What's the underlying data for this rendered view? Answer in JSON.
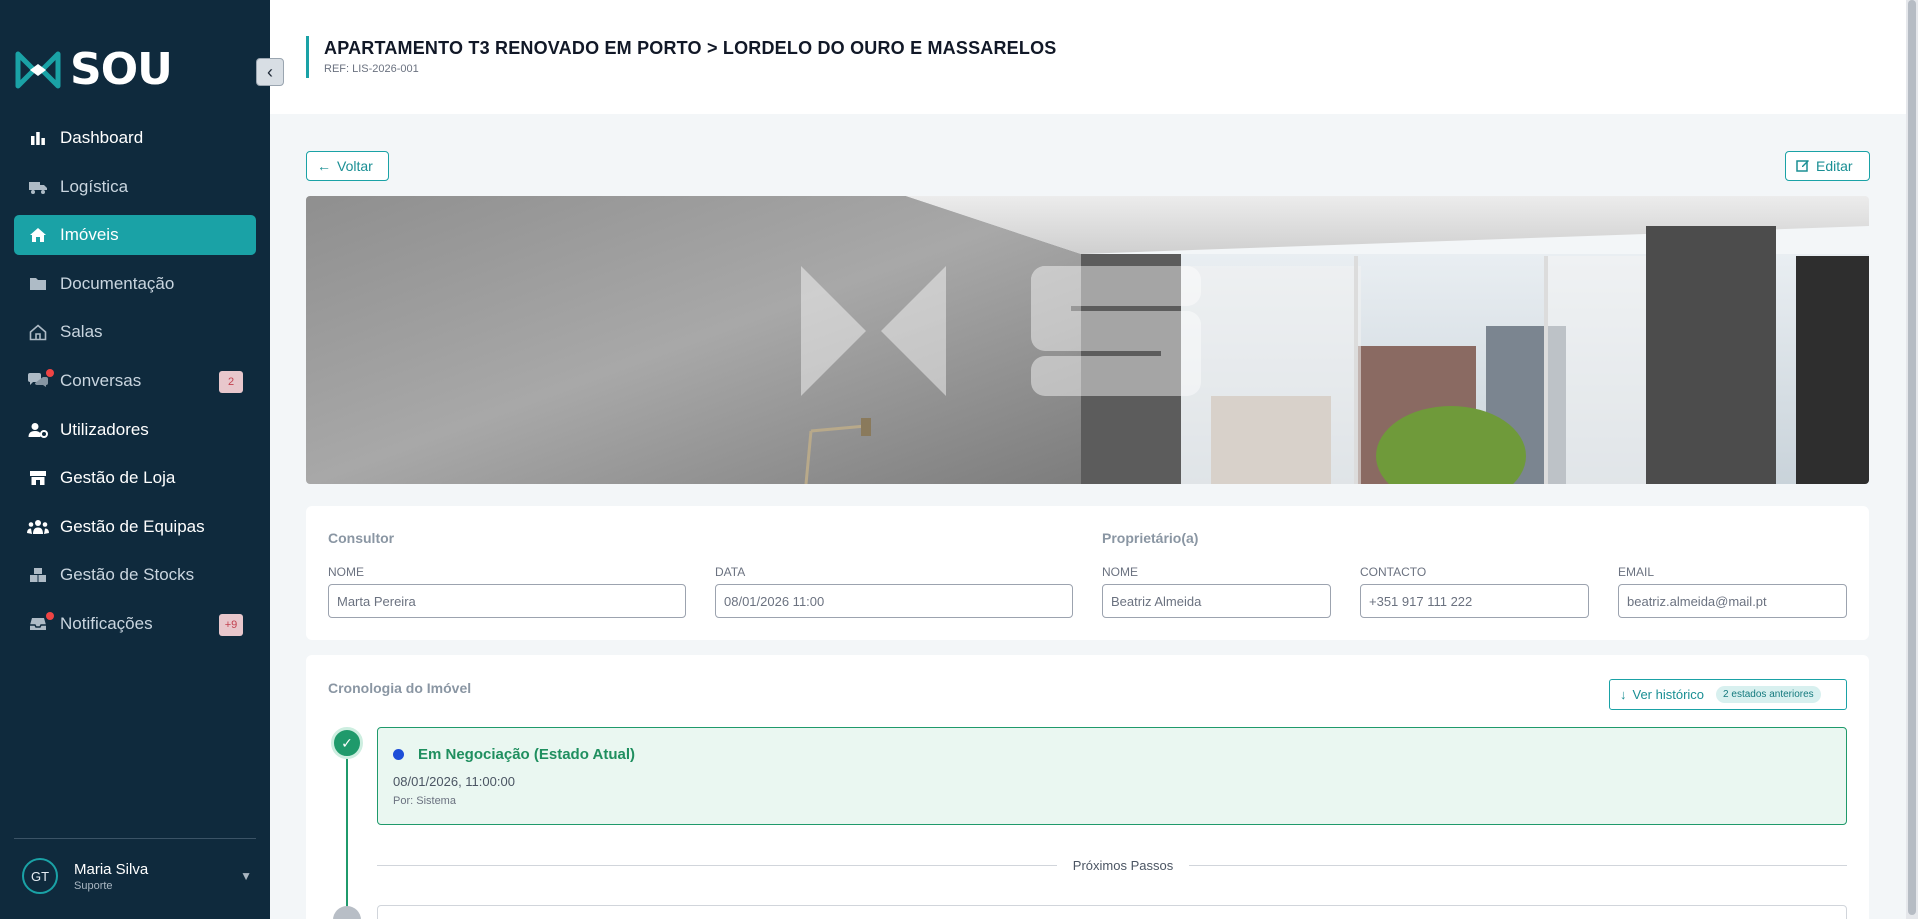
{
  "brand": {
    "name": "SOU"
  },
  "sidebar": {
    "items": [
      {
        "label": "Dashboard",
        "icon": "bar-chart-icon"
      },
      {
        "label": "Logística",
        "icon": "truck-icon"
      },
      {
        "label": "Imóveis",
        "icon": "home-icon",
        "active": true
      },
      {
        "label": "Documentação",
        "icon": "folder-icon"
      },
      {
        "label": "Salas",
        "icon": "house-outline-icon"
      },
      {
        "label": "Conversas",
        "icon": "chat-icon",
        "badge": "2"
      },
      {
        "label": "Utilizadores",
        "icon": "user-cog-icon"
      },
      {
        "label": "Gestão de Loja",
        "icon": "store-icon"
      },
      {
        "label": "Gestão de Equipas",
        "icon": "team-icon"
      },
      {
        "label": "Gestão de Stocks",
        "icon": "boxes-icon"
      },
      {
        "label": "Notificações",
        "icon": "inbox-icon",
        "badge": "+9"
      }
    ],
    "user": {
      "initials": "GT",
      "name": "Maria Silva",
      "role": "Suporte"
    }
  },
  "header": {
    "title": "APARTAMENTO T3 RENOVADO EM PORTO > LORDELO DO OURO E MASSARELOS",
    "ref": "REF: LIS-2026-001"
  },
  "actions": {
    "back": "Voltar",
    "edit": "Editar"
  },
  "consultor": {
    "title": "Consultor",
    "name_label": "NOME",
    "name_value": "Marta Pereira",
    "date_label": "DATA",
    "date_value": "08/01/2026 11:00"
  },
  "owner": {
    "title": "Proprietário(a)",
    "name_label": "NOME",
    "name_value": "Beatriz Almeida",
    "contact_label": "CONTACTO",
    "contact_value": "+351 917 111 222",
    "email_label": "EMAIL",
    "email_value": "beatriz.almeida@mail.pt"
  },
  "timeline": {
    "title": "Cronologia do Imóvel",
    "history_button": "Ver histórico",
    "history_count": "2 estados anteriores",
    "current": {
      "title": "Em Negociação (Estado Atual)",
      "date": "08/01/2026, 11:00:00",
      "by": "Por: Sistema"
    },
    "next_label": "Próximos Passos"
  },
  "colors": {
    "sidebar": "#0f2a3d",
    "accent": "#1aa2a6",
    "success": "#1f9a6b"
  }
}
